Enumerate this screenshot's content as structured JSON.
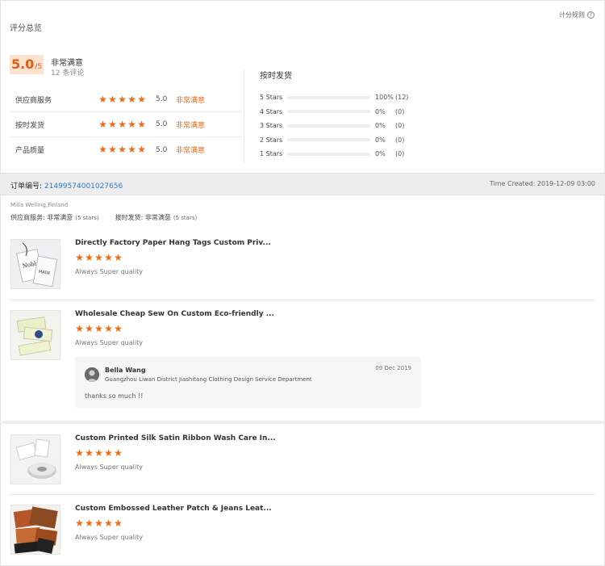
{
  "summary": {
    "title": "评分总览",
    "rules_link": "计分规则",
    "score": "5.0",
    "score_of": "/5",
    "overall_label": "非常满意",
    "review_count": "12 条评论",
    "rows": [
      {
        "label": "供应商服务",
        "score": "5.0",
        "text": "非常满意"
      },
      {
        "label": "按时发货",
        "score": "5.0",
        "text": "非常满意"
      },
      {
        "label": "产品质量",
        "score": "5.0",
        "text": "非常满意"
      }
    ],
    "distribution": {
      "title": "按时发货",
      "rows": [
        {
          "label": "5 Stars",
          "percent": 100,
          "pct_text": "100%",
          "count": "(12)"
        },
        {
          "label": "4 Stars",
          "percent": 0,
          "pct_text": "0%",
          "count": "(0)"
        },
        {
          "label": "3 Stars",
          "percent": 0,
          "pct_text": "0%",
          "count": "(0)"
        },
        {
          "label": "2 Stars",
          "percent": 0,
          "pct_text": "0%",
          "count": "(0)"
        },
        {
          "label": "1 Stars",
          "percent": 0,
          "pct_text": "0%",
          "count": "(0)"
        }
      ]
    }
  },
  "order": {
    "label": "订单编号: ",
    "id": "21499574001027656",
    "time": "Time Created: 2019-12-09 03:00",
    "buyer": "Milla Welling,Finland",
    "seller_ratings": [
      {
        "label": "供应商服务: 非常满意",
        "stars": "(5 stars)"
      },
      {
        "label": "按时发货: 非常满意",
        "stars": "(5 stars)"
      }
    ]
  },
  "reviews": [
    {
      "title": "Directly Factory Paper Hang Tags Custom Priv...",
      "comment": "Always Super quality",
      "rating": 5
    },
    {
      "title": "Wholesale Cheap Sew On Custom Eco-friendly ...",
      "comment": "Always Super quality",
      "rating": 5
    },
    {
      "title": "Custom Printed Silk Satin Ribbon Wash Care In...",
      "comment": "Always Super quality",
      "rating": 5
    },
    {
      "title": "Custom Embossed Leather Patch & Jeans Leat...",
      "comment": "Always Super quality",
      "rating": 5
    }
  ],
  "reply": {
    "name": "Bella Wang",
    "company": "Guangzhou Liwan District Jiashitang Clothing Design Service Department",
    "date": "09 Dec 2019",
    "text": "thanks so much !!"
  },
  "icons": {
    "star": "star-icon",
    "help": "help-circle-icon"
  },
  "colors": {
    "accent": "#f06a12",
    "score_bg": "#fde2cf",
    "link": "#2d7bc8"
  }
}
